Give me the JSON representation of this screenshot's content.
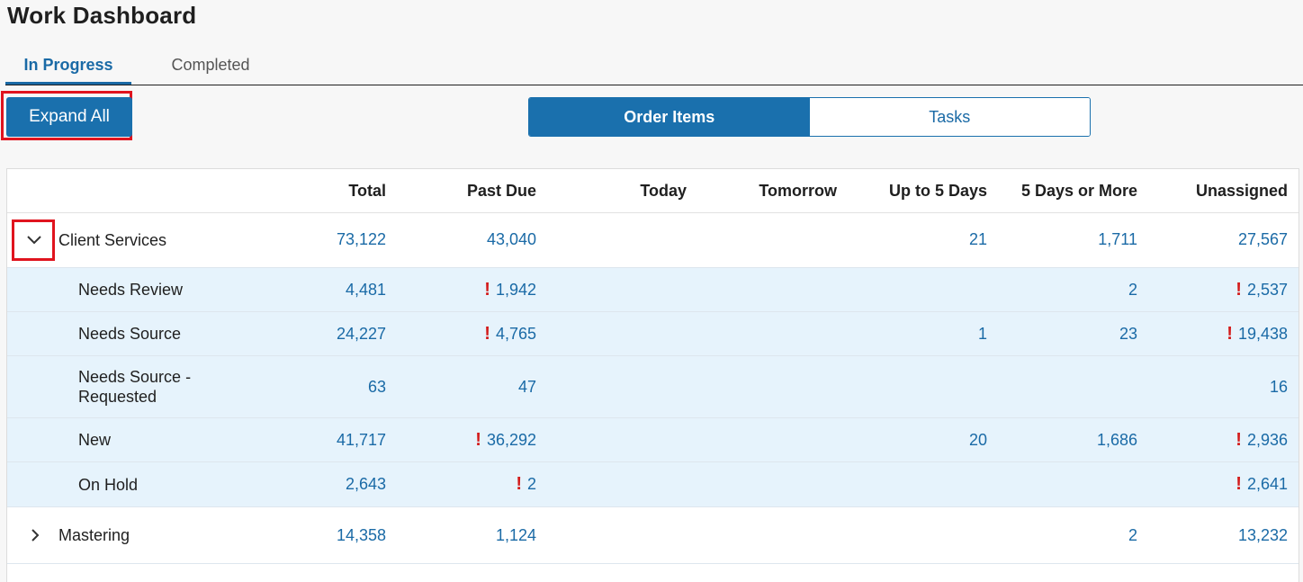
{
  "page": {
    "title": "Work Dashboard"
  },
  "tabs": [
    {
      "label": "In Progress",
      "active": true
    },
    {
      "label": "Completed",
      "active": false
    }
  ],
  "toolbar": {
    "expand_all_label": "Expand All"
  },
  "view_toggle": [
    {
      "label": "Order Items",
      "active": true
    },
    {
      "label": "Tasks",
      "active": false
    }
  ],
  "table": {
    "headers": {
      "total": "Total",
      "past_due": "Past Due",
      "today": "Today",
      "tomorrow": "Tomorrow",
      "up_to_5": "Up to 5 Days",
      "five_or_more": "5 Days or More",
      "unassigned": "Unassigned"
    },
    "groups": [
      {
        "name": "Client Services",
        "expanded": true,
        "total": "73,122",
        "past_due": "43,040",
        "today": "",
        "tomorrow": "",
        "up_to_5": "21",
        "five_or_more": "1,711",
        "unassigned": "27,567"
      },
      {
        "name": "Mastering",
        "expanded": false,
        "total": "14,358",
        "past_due": "1,124",
        "today": "",
        "tomorrow": "",
        "up_to_5": "",
        "five_or_more": "2",
        "unassigned": "13,232"
      }
    ],
    "client_services_rows": [
      {
        "name": "Needs Review",
        "total": "4,481",
        "past_due": "1,942",
        "past_due_warn": true,
        "today": "",
        "tomorrow": "",
        "up_to_5": "",
        "five_or_more": "2",
        "unassigned": "2,537",
        "unassigned_warn": true
      },
      {
        "name": "Needs Source",
        "total": "24,227",
        "past_due": "4,765",
        "past_due_warn": true,
        "today": "",
        "tomorrow": "",
        "up_to_5": "1",
        "five_or_more": "23",
        "unassigned": "19,438",
        "unassigned_warn": true
      },
      {
        "name": "Needs Source - Requested",
        "total": "63",
        "past_due": "47",
        "past_due_warn": false,
        "today": "",
        "tomorrow": "",
        "up_to_5": "",
        "five_or_more": "",
        "unassigned": "16",
        "unassigned_warn": false
      },
      {
        "name": "New",
        "total": "41,717",
        "past_due": "36,292",
        "past_due_warn": true,
        "today": "",
        "tomorrow": "",
        "up_to_5": "20",
        "five_or_more": "1,686",
        "unassigned": "2,936",
        "unassigned_warn": true
      },
      {
        "name": "On Hold",
        "total": "2,643",
        "past_due": "2",
        "past_due_warn": true,
        "today": "",
        "tomorrow": "",
        "up_to_5": "",
        "five_or_more": "",
        "unassigned": "2,641",
        "unassigned_warn": true
      }
    ]
  },
  "icons": {
    "warning": "exclamation-icon",
    "collapse": "chevron-down-icon",
    "expand": "chevron-right-icon"
  },
  "colors": {
    "accent": "#1a70ad",
    "link": "#1a6aa6",
    "warning": "#d31b1b",
    "highlight": "#e0141e",
    "child_row_bg": "#e6f3fc"
  }
}
